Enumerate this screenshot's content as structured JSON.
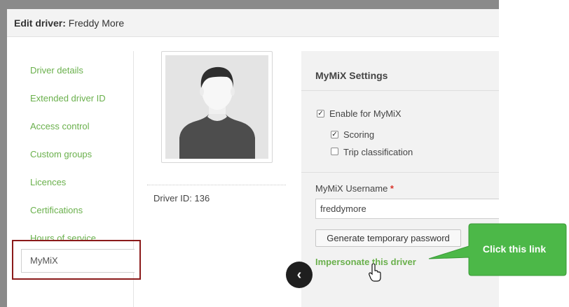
{
  "modal": {
    "title_label": "Edit driver:",
    "title_name": "Freddy More"
  },
  "sidebar": {
    "items": [
      {
        "label": "Driver details"
      },
      {
        "label": "Extended driver ID"
      },
      {
        "label": "Access control"
      },
      {
        "label": "Custom groups"
      },
      {
        "label": "Licences"
      },
      {
        "label": "Certifications"
      },
      {
        "label": "Hours of service"
      },
      {
        "label": "MyMiX",
        "active": true
      }
    ]
  },
  "profile": {
    "avatar_icon": "default-user-avatar",
    "driver_id_label": "Driver ID: 136"
  },
  "settings": {
    "title": "MyMiX Settings",
    "enable_label": "Enable for MyMiX",
    "enable_checked": true,
    "scoring_label": "Scoring",
    "scoring_checked": true,
    "trip_label": "Trip classification",
    "trip_checked": false,
    "username_label": "MyMiX Username",
    "required_mark": "*",
    "username_value": "freddymore",
    "generate_button": "Generate temporary password",
    "impersonate_link": "Impersonate this driver"
  },
  "annotation": {
    "callout_text": "Click this link",
    "callout_color": "#4cb848",
    "highlight_color": "#8b1a1a"
  },
  "colors": {
    "link_green": "#6ab04c",
    "panel_bg": "#f2f2f2"
  }
}
